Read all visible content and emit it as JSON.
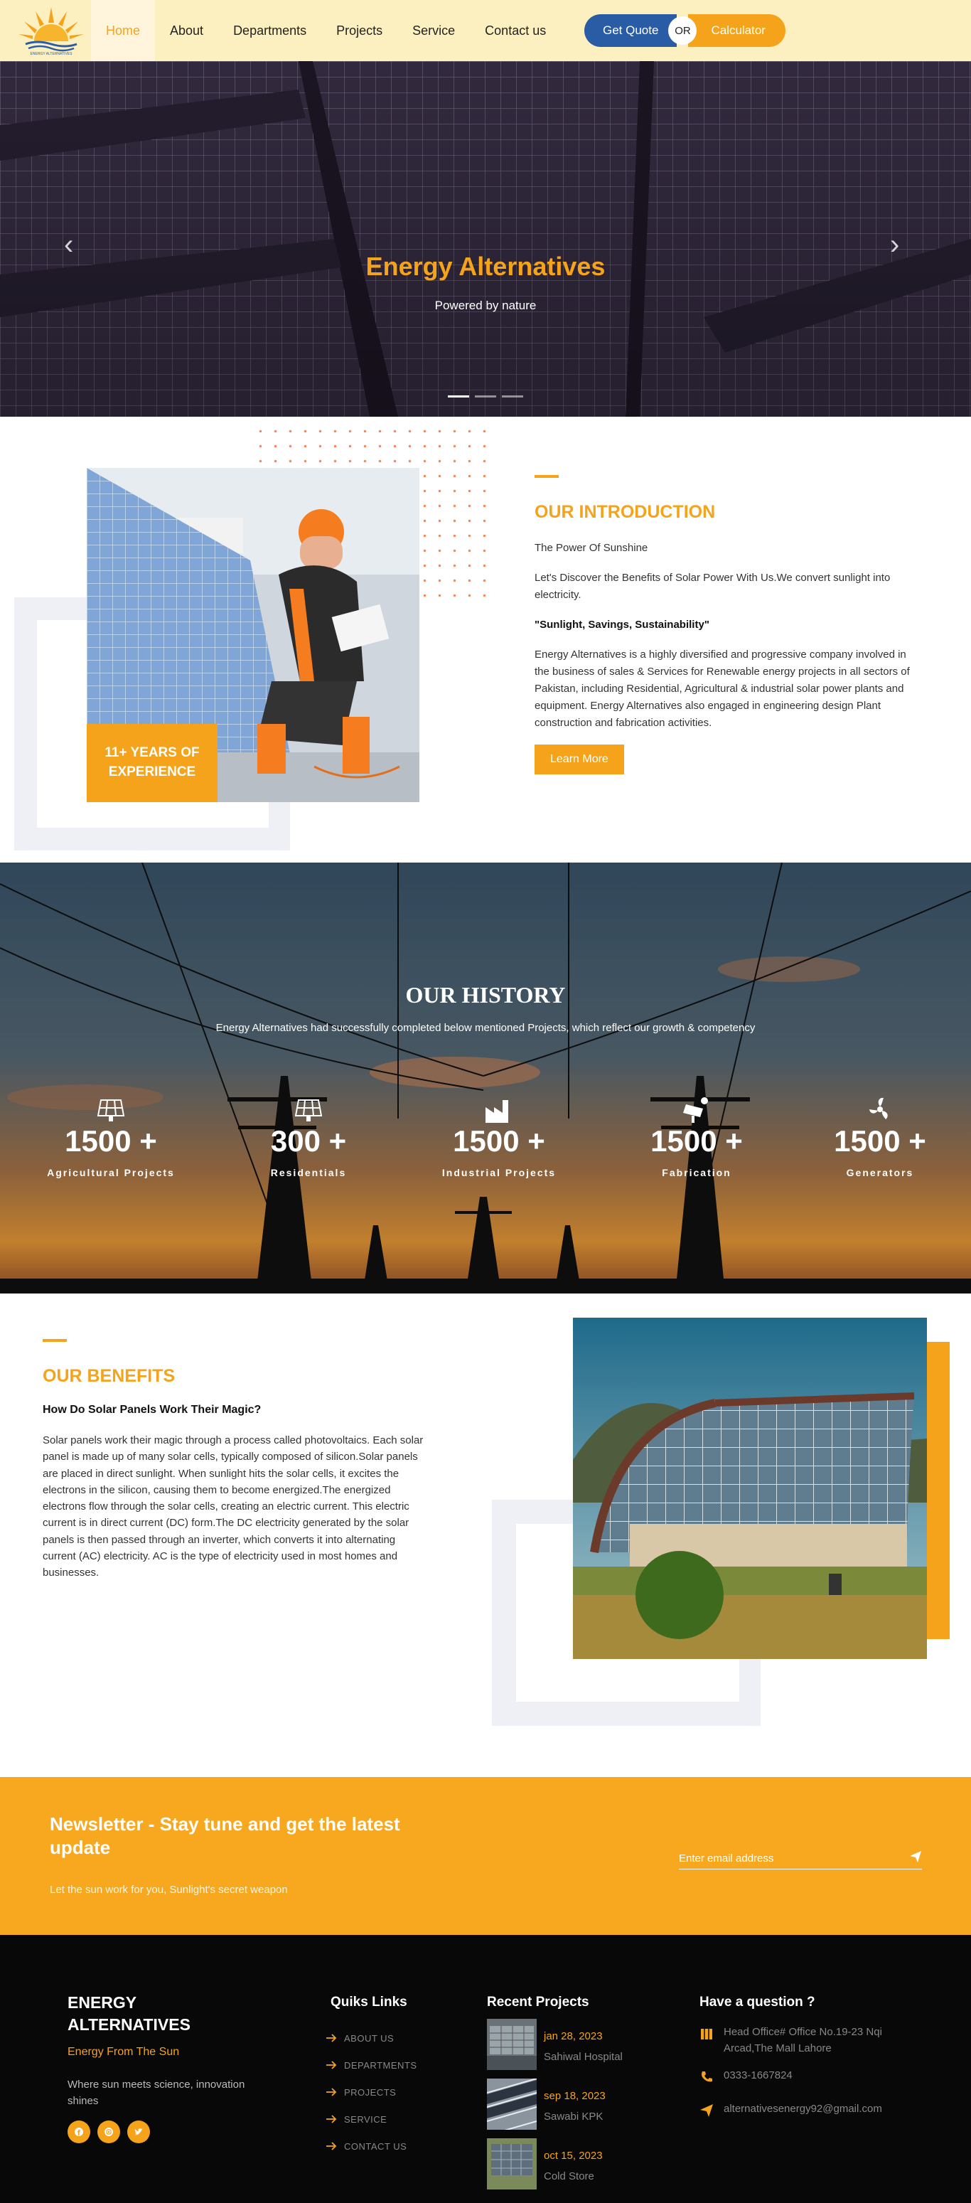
{
  "nav": {
    "items": [
      "Home",
      "About",
      "Departments",
      "Projects",
      "Service",
      "Contact us"
    ],
    "quote_label": "Get Quote",
    "or_label": "OR",
    "calc_label": "Calculator"
  },
  "hero": {
    "title": "Energy Alternatives",
    "subtitle": "Powered by nature",
    "prev_icon": "chevron-left-icon",
    "next_icon": "chevron-right-icon",
    "slides": 3,
    "active_slide": 1
  },
  "intro": {
    "years_badge": "11+ YEARS OF EXPERIENCE",
    "title": "OUR INTRODUCTION",
    "tagline": "The Power Of Sunshine",
    "lead": "Let's Discover the Benefits of Solar Power With Us.We convert sunlight into electricity.",
    "quote": "\"Sunlight, Savings, Sustainability\"",
    "body": "Energy Alternatives is a highly diversified and progressive company involved in the business of sales & Services for Renewable energy projects in all sectors of Pakistan, including Residential, Agricultural & industrial solar power plants and equipment. Energy Alternatives also engaged in engineering design Plant construction and fabrication activities.",
    "button": "Learn More"
  },
  "history": {
    "title": "OUR HISTORY",
    "subtitle": "Energy Alternatives had successfully completed below mentioned Projects, which reflect our growth & competency",
    "stats": [
      {
        "value": "1500 +",
        "label": "Agricultural Projects",
        "icon": "solar-panel-icon"
      },
      {
        "value": "300 +",
        "label": "Residentials",
        "icon": "solar-panel-icon"
      },
      {
        "value": "1500 +",
        "label": "Industrial Projects",
        "icon": "factory-icon"
      },
      {
        "value": "1500 +",
        "label": "Fabrication",
        "icon": "solar-tracker-icon"
      },
      {
        "value": "1500 +",
        "label": "Generators",
        "icon": "turbine-icon"
      }
    ]
  },
  "benefits": {
    "title": "OUR BENEFITS",
    "question": "How Do Solar Panels Work Their Magic?",
    "body": "Solar panels work their magic through a process called photovoltaics. Each solar panel is made up of many solar cells, typically composed of silicon.Solar panels are placed in direct sunlight. When sunlight hits the solar cells, it excites the electrons in the silicon, causing them to become energized.The energized electrons flow through the solar cells, creating an electric current. This electric current is in direct current (DC) form.The DC electricity generated by the solar panels is then passed through an inverter, which converts it into alternating current (AC) electricity. AC is the type of electricity used in most homes and businesses."
  },
  "newsletter": {
    "title": "Newsletter - Stay tune and get the latest update",
    "tagline": "Let the sun work for you, Sunlight's secret weapon",
    "placeholder": "Enter email address",
    "send_icon": "paper-plane-icon"
  },
  "footer": {
    "brand": "ENERGY ALTERNATIVES",
    "slogan": "Energy From The Sun",
    "desc": "Where sun meets science, innovation shines",
    "social_icons": [
      "facebook-icon",
      "instagram-icon",
      "twitter-icon"
    ],
    "links_title": "Quiks Links",
    "links": [
      "ABOUT US",
      "DEPARTMENTS",
      "PROJECTS",
      "SERVICE",
      "CONTACT US"
    ],
    "projects_title": "Recent Projects",
    "projects": [
      {
        "date": "jan 28, 2023",
        "name": "Sahiwal Hospital"
      },
      {
        "date": "sep 18, 2023",
        "name": "Sawabi KPK"
      },
      {
        "date": "oct 15, 2023",
        "name": "Cold Store"
      }
    ],
    "contact_title": "Have a question ?",
    "address": "Head Office# Office No.19-23 Nqi Arcad,The Mall Lahore",
    "phone": "0333-1667824",
    "email": "alternativesenergy92@gmail.com"
  },
  "colors": {
    "accent": "#f5a31a",
    "nav_bg": "#fdf0c0",
    "quote_btn": "#2a5ca6",
    "footer_bg": "#080808"
  }
}
